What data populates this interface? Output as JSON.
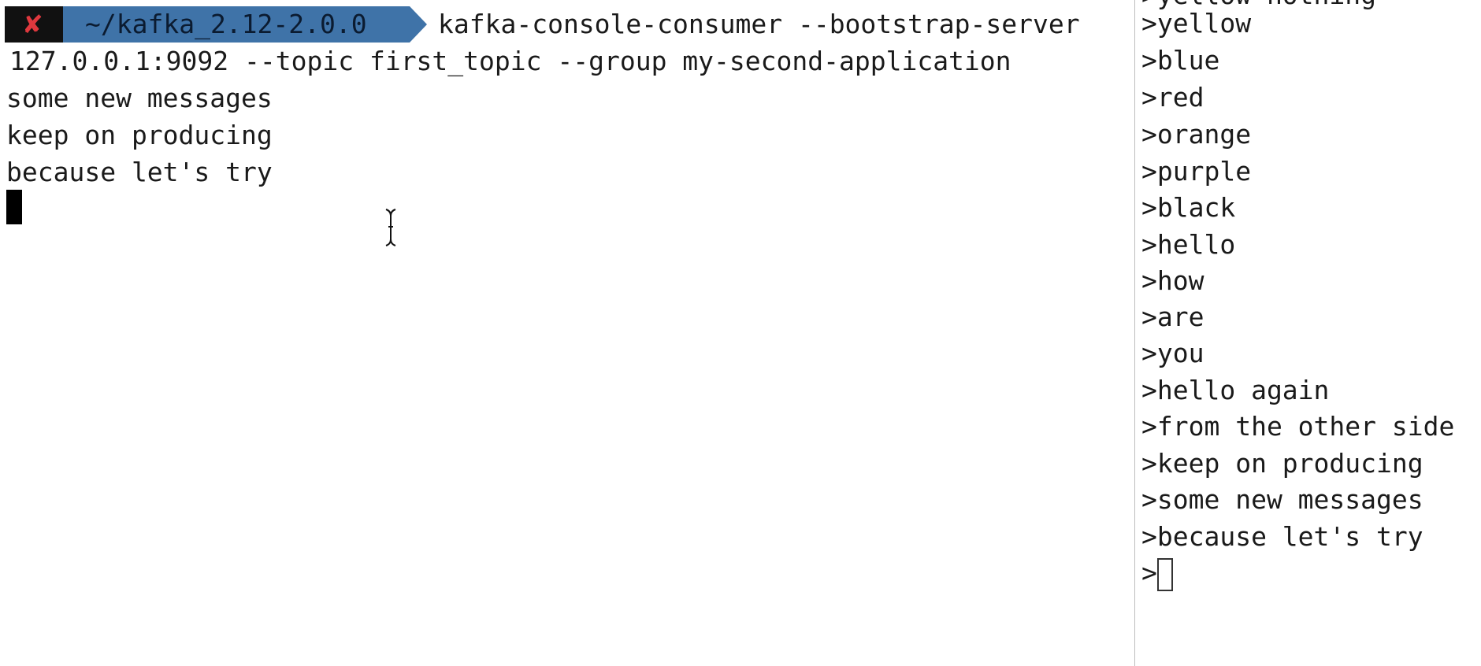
{
  "consumer_pane": {
    "prompt": {
      "status_icon": "x-icon",
      "status_color": "#e0383e",
      "directory": "~/kafka_2.12-2.0.0",
      "directory_bg": "#3f73a8"
    },
    "command_line_1": "kafka-console-consumer --bootstrap-server",
    "command_line_2": "127.0.0.1:9092 --topic first_topic --group my-second-application",
    "output": [
      "some new messages",
      "keep on producing",
      "because let's try"
    ]
  },
  "producer_pane": {
    "cut_off_line": ">yellow nothing",
    "lines": [
      ">yellow",
      ">blue",
      ">red",
      ">orange",
      ">purple",
      ">black",
      ">hello",
      ">how",
      ">are",
      ">you",
      ">hello again",
      ">from the other side",
      ">keep on producing",
      ">some new messages",
      ">because let's try"
    ],
    "input_prompt": ">"
  }
}
